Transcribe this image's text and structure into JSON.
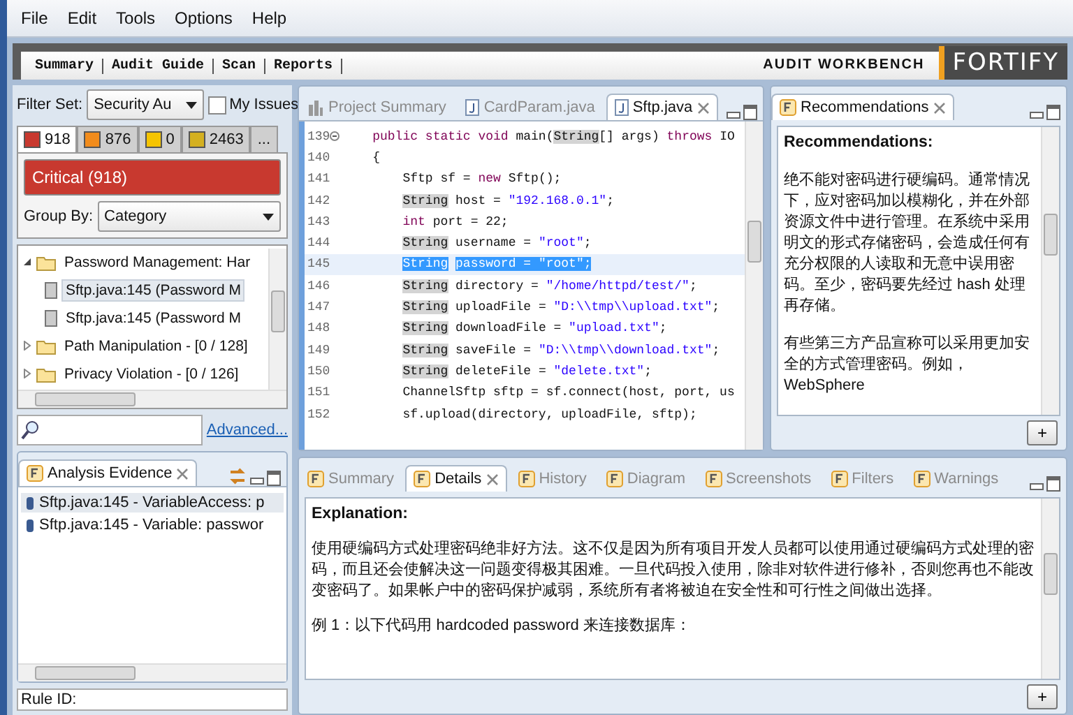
{
  "menu": [
    "File",
    "Edit",
    "Tools",
    "Options",
    "Help"
  ],
  "nav_tabs": [
    "Summary",
    "Audit Guide",
    "Scan",
    "Reports"
  ],
  "banner_title": "AUDIT WORKBENCH",
  "logo": "FORTIFY",
  "filter": {
    "label": "Filter Set:",
    "value": "Security Au",
    "my_issues": {
      "label": "My Issues",
      "checked": false
    }
  },
  "severity_tabs": [
    {
      "count": "918",
      "color": "#c8392f",
      "selected": true
    },
    {
      "count": "876",
      "color": "#f28c1c",
      "selected": false
    },
    {
      "count": "0",
      "color": "#f5c400",
      "selected": false
    },
    {
      "count": "2463",
      "color": "#d4b020",
      "selected": false
    }
  ],
  "more_tab": "...",
  "severity_bar": {
    "label": "Critical (918)",
    "color": "#c8392f"
  },
  "group_by": {
    "label": "Group By:",
    "value": "Category"
  },
  "tree": [
    {
      "label": "Password Management: Har",
      "expanded": true,
      "selected": false,
      "children": [
        {
          "label": "Sftp.java:145 (Password M",
          "selected": true
        },
        {
          "label": "Sftp.java:145 (Password M",
          "selected": false
        }
      ]
    },
    {
      "label": "Path Manipulation - [0 / 128]",
      "expanded": false,
      "selected": false
    },
    {
      "label": "Privacy Violation - [0 / 126]",
      "expanded": false,
      "selected": false
    }
  ],
  "search": {
    "link": "Advanced..."
  },
  "evidence": {
    "title": "Analysis Evidence",
    "items": [
      {
        "label": "Sftp.java:145 - VariableAccess: p",
        "selected": true
      },
      {
        "label": "Sftp.java:145 - Variable: passwor",
        "selected": false
      }
    ]
  },
  "rule_id": "Rule ID:",
  "editor": {
    "tabs": [
      {
        "label": "Project Summary",
        "kind": "summary",
        "selected": false
      },
      {
        "label": "CardParam.java",
        "kind": "java",
        "selected": false
      },
      {
        "label": "Sftp.java",
        "kind": "java",
        "selected": true
      }
    ],
    "lines": [
      {
        "number": "139",
        "foldable": true,
        "selected": false,
        "tokens": [
          {
            "kind": "kw",
            "text": "    public static void"
          },
          {
            "kind": "plain",
            "text": " main("
          },
          {
            "kind": "type",
            "text": "String"
          },
          {
            "kind": "plain",
            "text": "[] args) "
          },
          {
            "kind": "kw",
            "text": "throws"
          },
          {
            "kind": "plain",
            "text": " IO"
          }
        ]
      },
      {
        "number": "140",
        "foldable": false,
        "selected": false,
        "tokens": [
          {
            "kind": "plain",
            "text": "    {"
          }
        ]
      },
      {
        "number": "141",
        "foldable": false,
        "selected": false,
        "tokens": [
          {
            "kind": "plain",
            "text": "        Sftp sf = "
          },
          {
            "kind": "kw",
            "text": "new"
          },
          {
            "kind": "plain",
            "text": " Sftp();"
          }
        ]
      },
      {
        "number": "142",
        "foldable": false,
        "selected": false,
        "tokens": [
          {
            "kind": "type",
            "text": "        String"
          },
          {
            "kind": "plain",
            "text": " host = "
          },
          {
            "kind": "str",
            "text": "\"192.168.0.1\""
          },
          {
            "kind": "plain",
            "text": ";"
          }
        ]
      },
      {
        "number": "143",
        "foldable": false,
        "selected": false,
        "tokens": [
          {
            "kind": "kw",
            "text": "        int"
          },
          {
            "kind": "plain",
            "text": " port = 22;"
          }
        ]
      },
      {
        "number": "144",
        "foldable": false,
        "selected": false,
        "tokens": [
          {
            "kind": "type",
            "text": "        String"
          },
          {
            "kind": "plain",
            "text": " username = "
          },
          {
            "kind": "str",
            "text": "\"root\""
          },
          {
            "kind": "plain",
            "text": ";"
          }
        ]
      },
      {
        "number": "145",
        "foldable": false,
        "selected": true,
        "tokens": [
          {
            "kind": "type",
            "text": "        String"
          },
          {
            "kind": "plain",
            "text": " password = "
          },
          {
            "kind": "str",
            "text": "\"root\""
          },
          {
            "kind": "plain",
            "text": ";"
          }
        ]
      },
      {
        "number": "146",
        "foldable": false,
        "selected": false,
        "tokens": [
          {
            "kind": "type",
            "text": "        String"
          },
          {
            "kind": "plain",
            "text": " directory = "
          },
          {
            "kind": "str",
            "text": "\"/home/httpd/test/\""
          },
          {
            "kind": "plain",
            "text": ";"
          }
        ]
      },
      {
        "number": "147",
        "foldable": false,
        "selected": false,
        "tokens": [
          {
            "kind": "type",
            "text": "        String"
          },
          {
            "kind": "plain",
            "text": " uploadFile = "
          },
          {
            "kind": "str",
            "text": "\"D:\\\\tmp\\\\upload.txt\""
          },
          {
            "kind": "plain",
            "text": ";"
          }
        ]
      },
      {
        "number": "148",
        "foldable": false,
        "selected": false,
        "tokens": [
          {
            "kind": "type",
            "text": "        String"
          },
          {
            "kind": "plain",
            "text": " downloadFile = "
          },
          {
            "kind": "str",
            "text": "\"upload.txt\""
          },
          {
            "kind": "plain",
            "text": ";"
          }
        ]
      },
      {
        "number": "149",
        "foldable": false,
        "selected": false,
        "tokens": [
          {
            "kind": "type",
            "text": "        String"
          },
          {
            "kind": "plain",
            "text": " saveFile = "
          },
          {
            "kind": "str",
            "text": "\"D:\\\\tmp\\\\download.txt\""
          },
          {
            "kind": "plain",
            "text": ";"
          }
        ]
      },
      {
        "number": "150",
        "foldable": false,
        "selected": false,
        "tokens": [
          {
            "kind": "type",
            "text": "        String"
          },
          {
            "kind": "plain",
            "text": " deleteFile = "
          },
          {
            "kind": "str",
            "text": "\"delete.txt\""
          },
          {
            "kind": "plain",
            "text": ";"
          }
        ]
      },
      {
        "number": "151",
        "foldable": false,
        "selected": false,
        "tokens": [
          {
            "kind": "plain",
            "text": "        ChannelSftp sftp = sf.connect(host, port, us"
          }
        ]
      },
      {
        "number": "152",
        "foldable": false,
        "selected": false,
        "tokens": [
          {
            "kind": "plain",
            "text": "        sf.upload(directory, uploadFile, sftp);"
          }
        ]
      }
    ]
  },
  "recommendations": {
    "title": "Recommendations",
    "heading": "Recommendations:",
    "paragraphs": [
      "绝不能对密码进行硬编码。通常情况下，应对密码加以模糊化，并在外部资源文件中进行管理。在系统中采用明文的形式存储密码，会造成任何有充分权限的人读取和无意中误用密码。至少，密码要先经过 hash 处理再存储。",
      "有些第三方产品宣称可以采用更加安全的方式管理密码。例如，WebSphere"
    ],
    "add_button": "+"
  },
  "details": {
    "tabs": [
      {
        "label": "Summary",
        "selected": false
      },
      {
        "label": "Details",
        "selected": true
      },
      {
        "label": "History",
        "selected": false
      },
      {
        "label": "Diagram",
        "selected": false
      },
      {
        "label": "Screenshots",
        "selected": false
      },
      {
        "label": "Filters",
        "selected": false
      },
      {
        "label": "Warnings",
        "selected": false
      }
    ],
    "heading": "Explanation:",
    "paragraphs": [
      "使用硬编码方式处理密码绝非好方法。这不仅是因为所有项目开发人员都可以使用通过硬编码方式处理的密码，而且还会使解决这一问题变得极其困难。一旦代码投入使用，除非对软件进行修补，否则您再也不能改变密码了。如果帐户中的密码保护减弱，系统所有者将被迫在安全性和可行性之间做出选择。",
      "例 1：以下代码用 hardcoded password 来连接数据库："
    ],
    "add_button": "+"
  }
}
